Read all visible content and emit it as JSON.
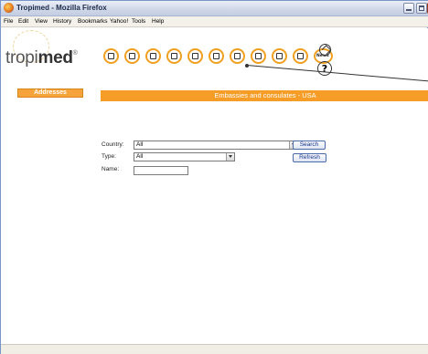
{
  "window": {
    "title": "Tropimed - Mozilla Firefox"
  },
  "menubar": {
    "items": [
      "File",
      "Edit",
      "View",
      "History",
      "Bookmarks",
      "Yahoo!",
      "Tools",
      "Help"
    ]
  },
  "logo": {
    "text_light": "tropi",
    "text_bold": "med",
    "mark": "®"
  },
  "toolbar_icons": [
    "globe-icon",
    "syringe-icon",
    "first-aid-icon",
    "hospital-icon",
    "mountain-icon",
    "document-icon",
    "map-icon",
    "home-plus-icon",
    "passport-icon",
    "book-icon",
    "news-icon"
  ],
  "news_label": "News",
  "sidebar": {
    "active_item": "Addresses"
  },
  "banner": {
    "title": "Embassies and consulates - USA"
  },
  "form": {
    "country_label": "Country:",
    "country_value": "All",
    "type_label": "Type:",
    "type_value": "All",
    "name_label": "Name:",
    "name_value": "",
    "search_button": "Search",
    "refresh_button": "Refresh"
  },
  "colors": {
    "accent": "#f59d27",
    "link": "#12318a"
  }
}
